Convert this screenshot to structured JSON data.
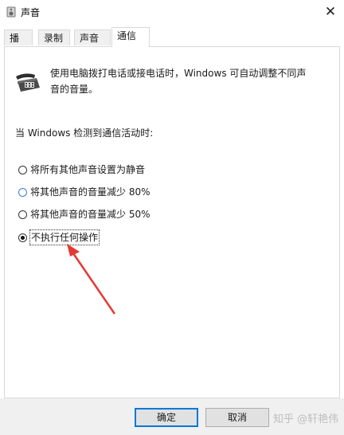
{
  "window": {
    "title": "声音",
    "close_glyph": "✕"
  },
  "tabs": [
    {
      "label": "播放",
      "active": false
    },
    {
      "label": "录制",
      "active": false
    },
    {
      "label": "声音",
      "active": false
    },
    {
      "label": "通信",
      "active": true
    }
  ],
  "communications": {
    "icon": "telephone-icon",
    "description": "使用电脑拨打电话或接电话时，Windows 可自动调整不同声音的音量。",
    "heading": "当 Windows 检测到通信活动时:",
    "options": [
      {
        "label": "将所有其他声音设置为静音",
        "selected": false
      },
      {
        "label": "将其他声音的音量减少 80%",
        "selected": false
      },
      {
        "label": "将其他声音的音量减少 50%",
        "selected": false
      },
      {
        "label": "不执行任何操作",
        "selected": true
      }
    ]
  },
  "annotation": {
    "arrow_color": "#e53935"
  },
  "buttons": {
    "ok": "确定",
    "cancel": "取消"
  },
  "watermark": "知乎 @轩艳伟"
}
